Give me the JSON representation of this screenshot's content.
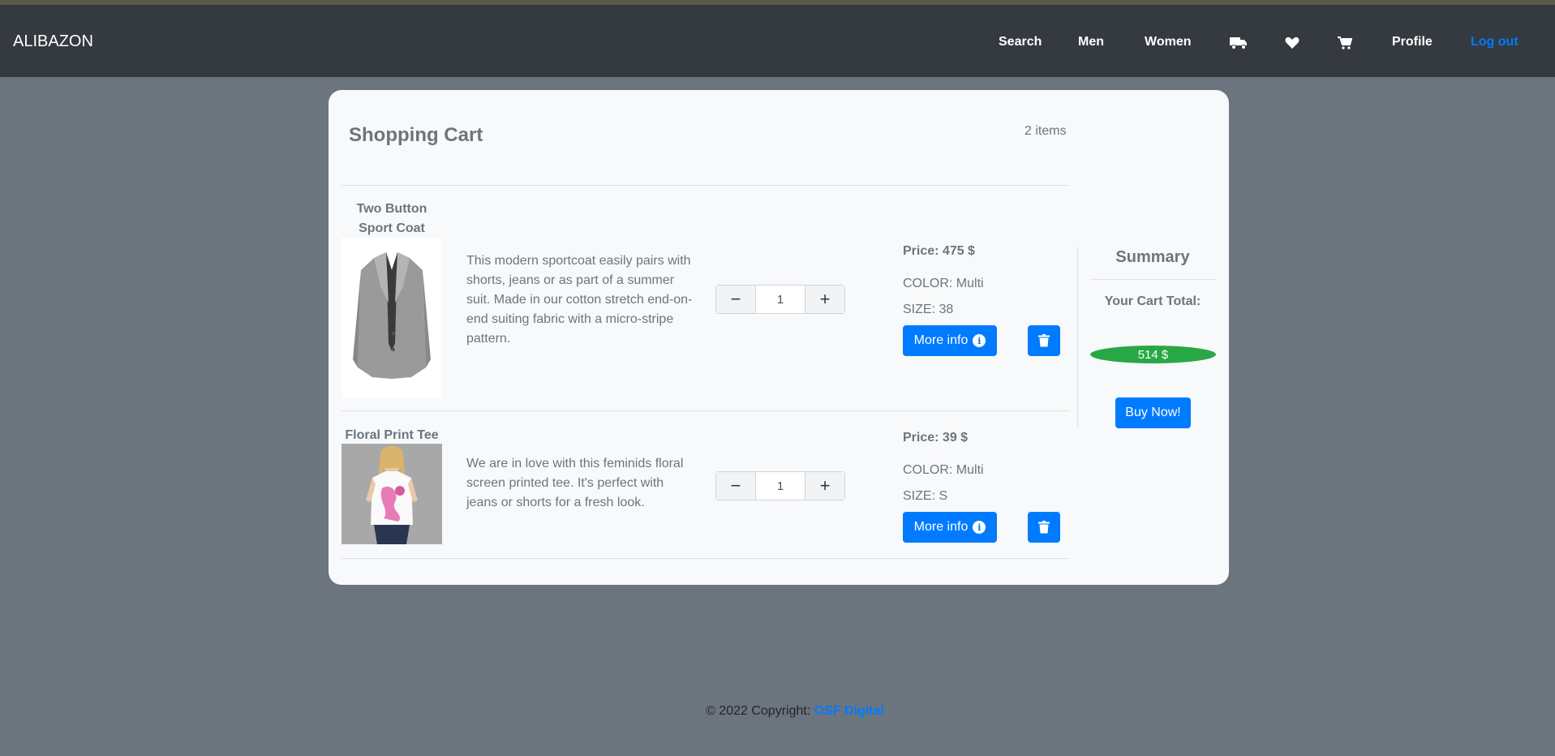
{
  "navbar": {
    "brand": "ALIBAZON",
    "links": {
      "search": "Search",
      "men": "Men",
      "women": "Women",
      "profile": "Profile",
      "logout": "Log out"
    },
    "icons": [
      "truck-icon",
      "heart-icon",
      "cart-icon"
    ]
  },
  "cart": {
    "title": "Shopping Cart",
    "item_count": "2 items",
    "items": [
      {
        "name": "Two Button Sport Coat",
        "description": "This modern sportcoat easily pairs with shorts, jeans or as part of a summer suit. Made in our cotton stretch end-on-end suiting fabric with a micro-stripe pattern.",
        "quantity": "1",
        "price": "Price: 475 $",
        "color": "COLOR: Multi",
        "size": "SIZE: 38",
        "more_info": "More info"
      },
      {
        "name": "Floral Print Tee",
        "description": "We are in love with this feminids floral screen printed tee. It's perfect with jeans or shorts for a fresh look.",
        "quantity": "1",
        "price": "Price: 39 $",
        "color": "COLOR: Multi",
        "size": "SIZE: S",
        "more_info": "More info"
      }
    ]
  },
  "summary": {
    "title": "Summary",
    "total_label": "Your Cart Total:",
    "total_value": "514 $",
    "buy_label": "Buy Now!"
  },
  "footer": {
    "text": "© 2022 Copyright: ",
    "link": "OSF Digital"
  },
  "colors": {
    "page_bg": "#6c757d",
    "navbar_bg": "#343a40",
    "card_bg": "#f8f9fa",
    "primary": "#007bff",
    "success": "#28a745"
  }
}
